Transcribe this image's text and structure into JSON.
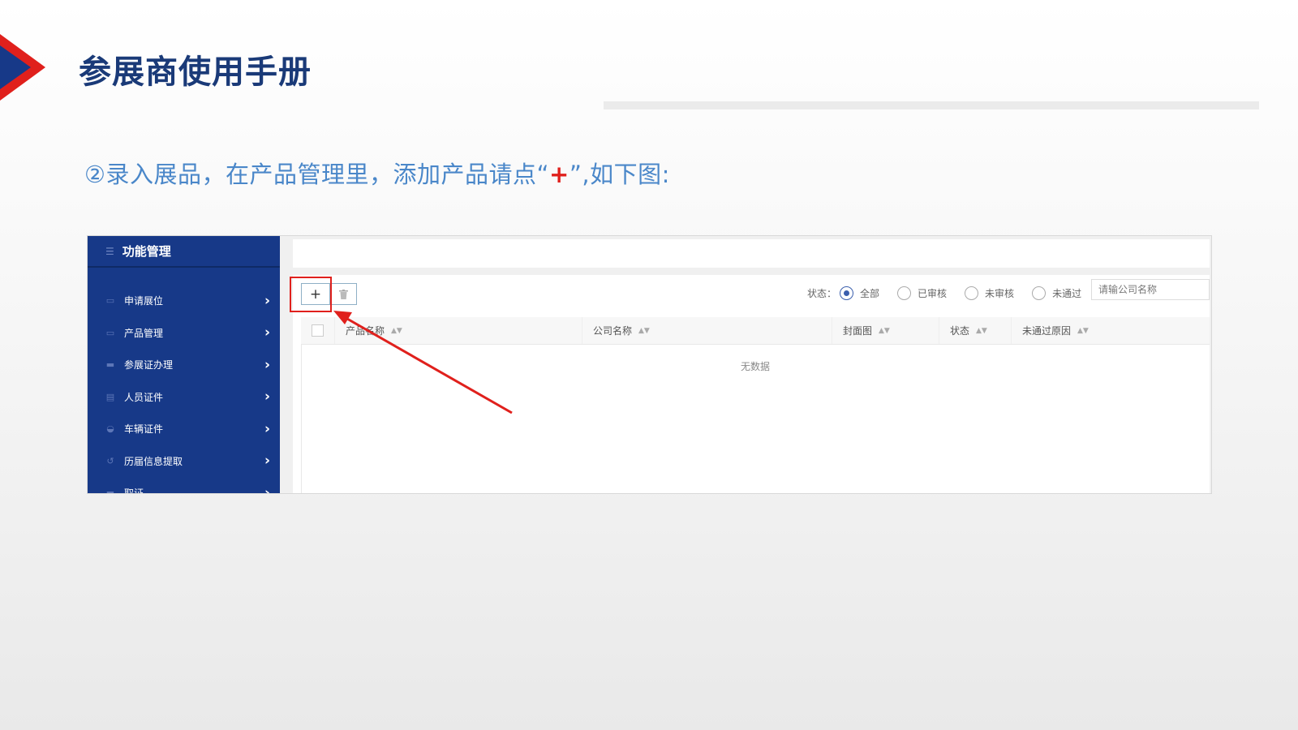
{
  "slide": {
    "title": "参展商使用手册",
    "instruction_pre": "②录入展品，在产品管理里，添加产品请点“",
    "instruction_plus": "+",
    "instruction_post": "”,如下图:"
  },
  "colors": {
    "brand_blue": "#173988",
    "accent_red": "#e0201c",
    "instruction_blue": "#4a87c9"
  },
  "sidebar": {
    "title": "功能管理",
    "title_icon": "list-icon",
    "items": [
      {
        "label": "申请展位",
        "icon": "monitor-icon"
      },
      {
        "label": "产品管理",
        "icon": "monitor-icon"
      },
      {
        "label": "参展证办理",
        "icon": "card-icon"
      },
      {
        "label": "人员证件",
        "icon": "id-card-icon"
      },
      {
        "label": "车辆证件",
        "icon": "car-icon"
      },
      {
        "label": "历届信息提取",
        "icon": "history-icon"
      },
      {
        "label": "取证",
        "icon": "card-icon"
      }
    ]
  },
  "toolbar": {
    "add_label": "+",
    "delete_icon": "trash-icon",
    "status_label": "状态：",
    "status_options": [
      {
        "label": "全部",
        "selected": true
      },
      {
        "label": "已审核",
        "selected": false
      },
      {
        "label": "未审核",
        "selected": false
      },
      {
        "label": "未通过",
        "selected": false
      }
    ],
    "search_placeholder": "请输公司名称"
  },
  "table": {
    "columns": [
      "产品名称",
      "公司名称",
      "封面图",
      "状态",
      "未通过原因"
    ],
    "empty_text": "无数据"
  }
}
